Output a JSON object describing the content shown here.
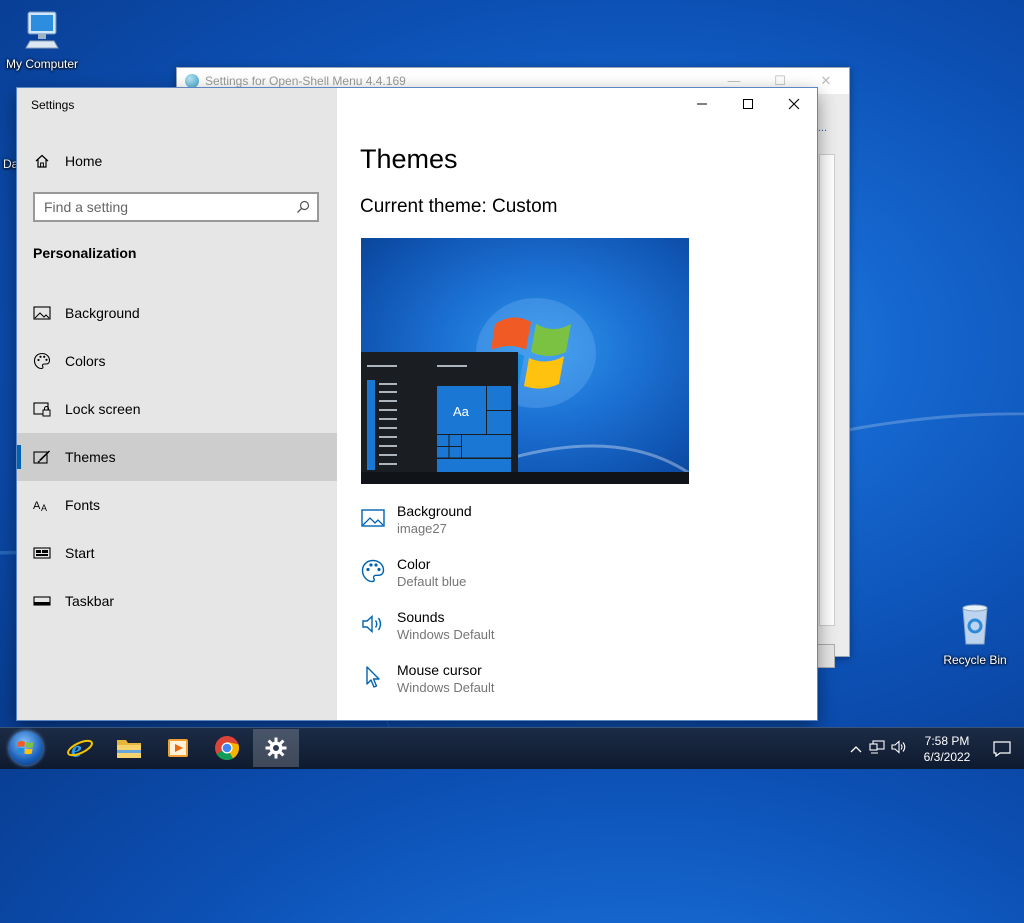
{
  "desktop": {
    "icons": [
      {
        "label": "My Computer"
      },
      {
        "label": "Recycle Bin"
      }
    ],
    "partial_icon_label": "Da"
  },
  "background_window": {
    "title": "Settings for Open-Shell Menu 4.4.169"
  },
  "settings": {
    "app_title": "Settings",
    "home_label": "Home",
    "search_placeholder": "Find a setting",
    "section_title": "Personalization",
    "nav_items": [
      {
        "label": "Background",
        "icon": "image-icon"
      },
      {
        "label": "Colors",
        "icon": "palette-icon"
      },
      {
        "label": "Lock screen",
        "icon": "lock-screen-icon"
      },
      {
        "label": "Themes",
        "icon": "themes-brush-icon",
        "active": true
      },
      {
        "label": "Fonts",
        "icon": "fonts-icon"
      },
      {
        "label": "Start",
        "icon": "start-icon"
      },
      {
        "label": "Taskbar",
        "icon": "taskbar-icon"
      }
    ],
    "page_title": "Themes",
    "current_theme": "Current theme: Custom",
    "preview_tile_text": "Aa",
    "theme_items": [
      {
        "label": "Background",
        "value": "image27",
        "icon": "image-icon"
      },
      {
        "label": "Color",
        "value": "Default blue",
        "icon": "palette-icon"
      },
      {
        "label": "Sounds",
        "value": "Windows Default",
        "icon": "speaker-icon"
      },
      {
        "label": "Mouse cursor",
        "value": "Windows Default",
        "icon": "cursor-icon"
      }
    ],
    "accent_color": "#0063b1"
  },
  "taskbar": {
    "pinned": [
      "internet-explorer-icon",
      "file-explorer-icon",
      "media-player-icon",
      "chrome-icon",
      "settings-gear-icon"
    ],
    "time": "7:58 PM",
    "date": "6/3/2022"
  }
}
